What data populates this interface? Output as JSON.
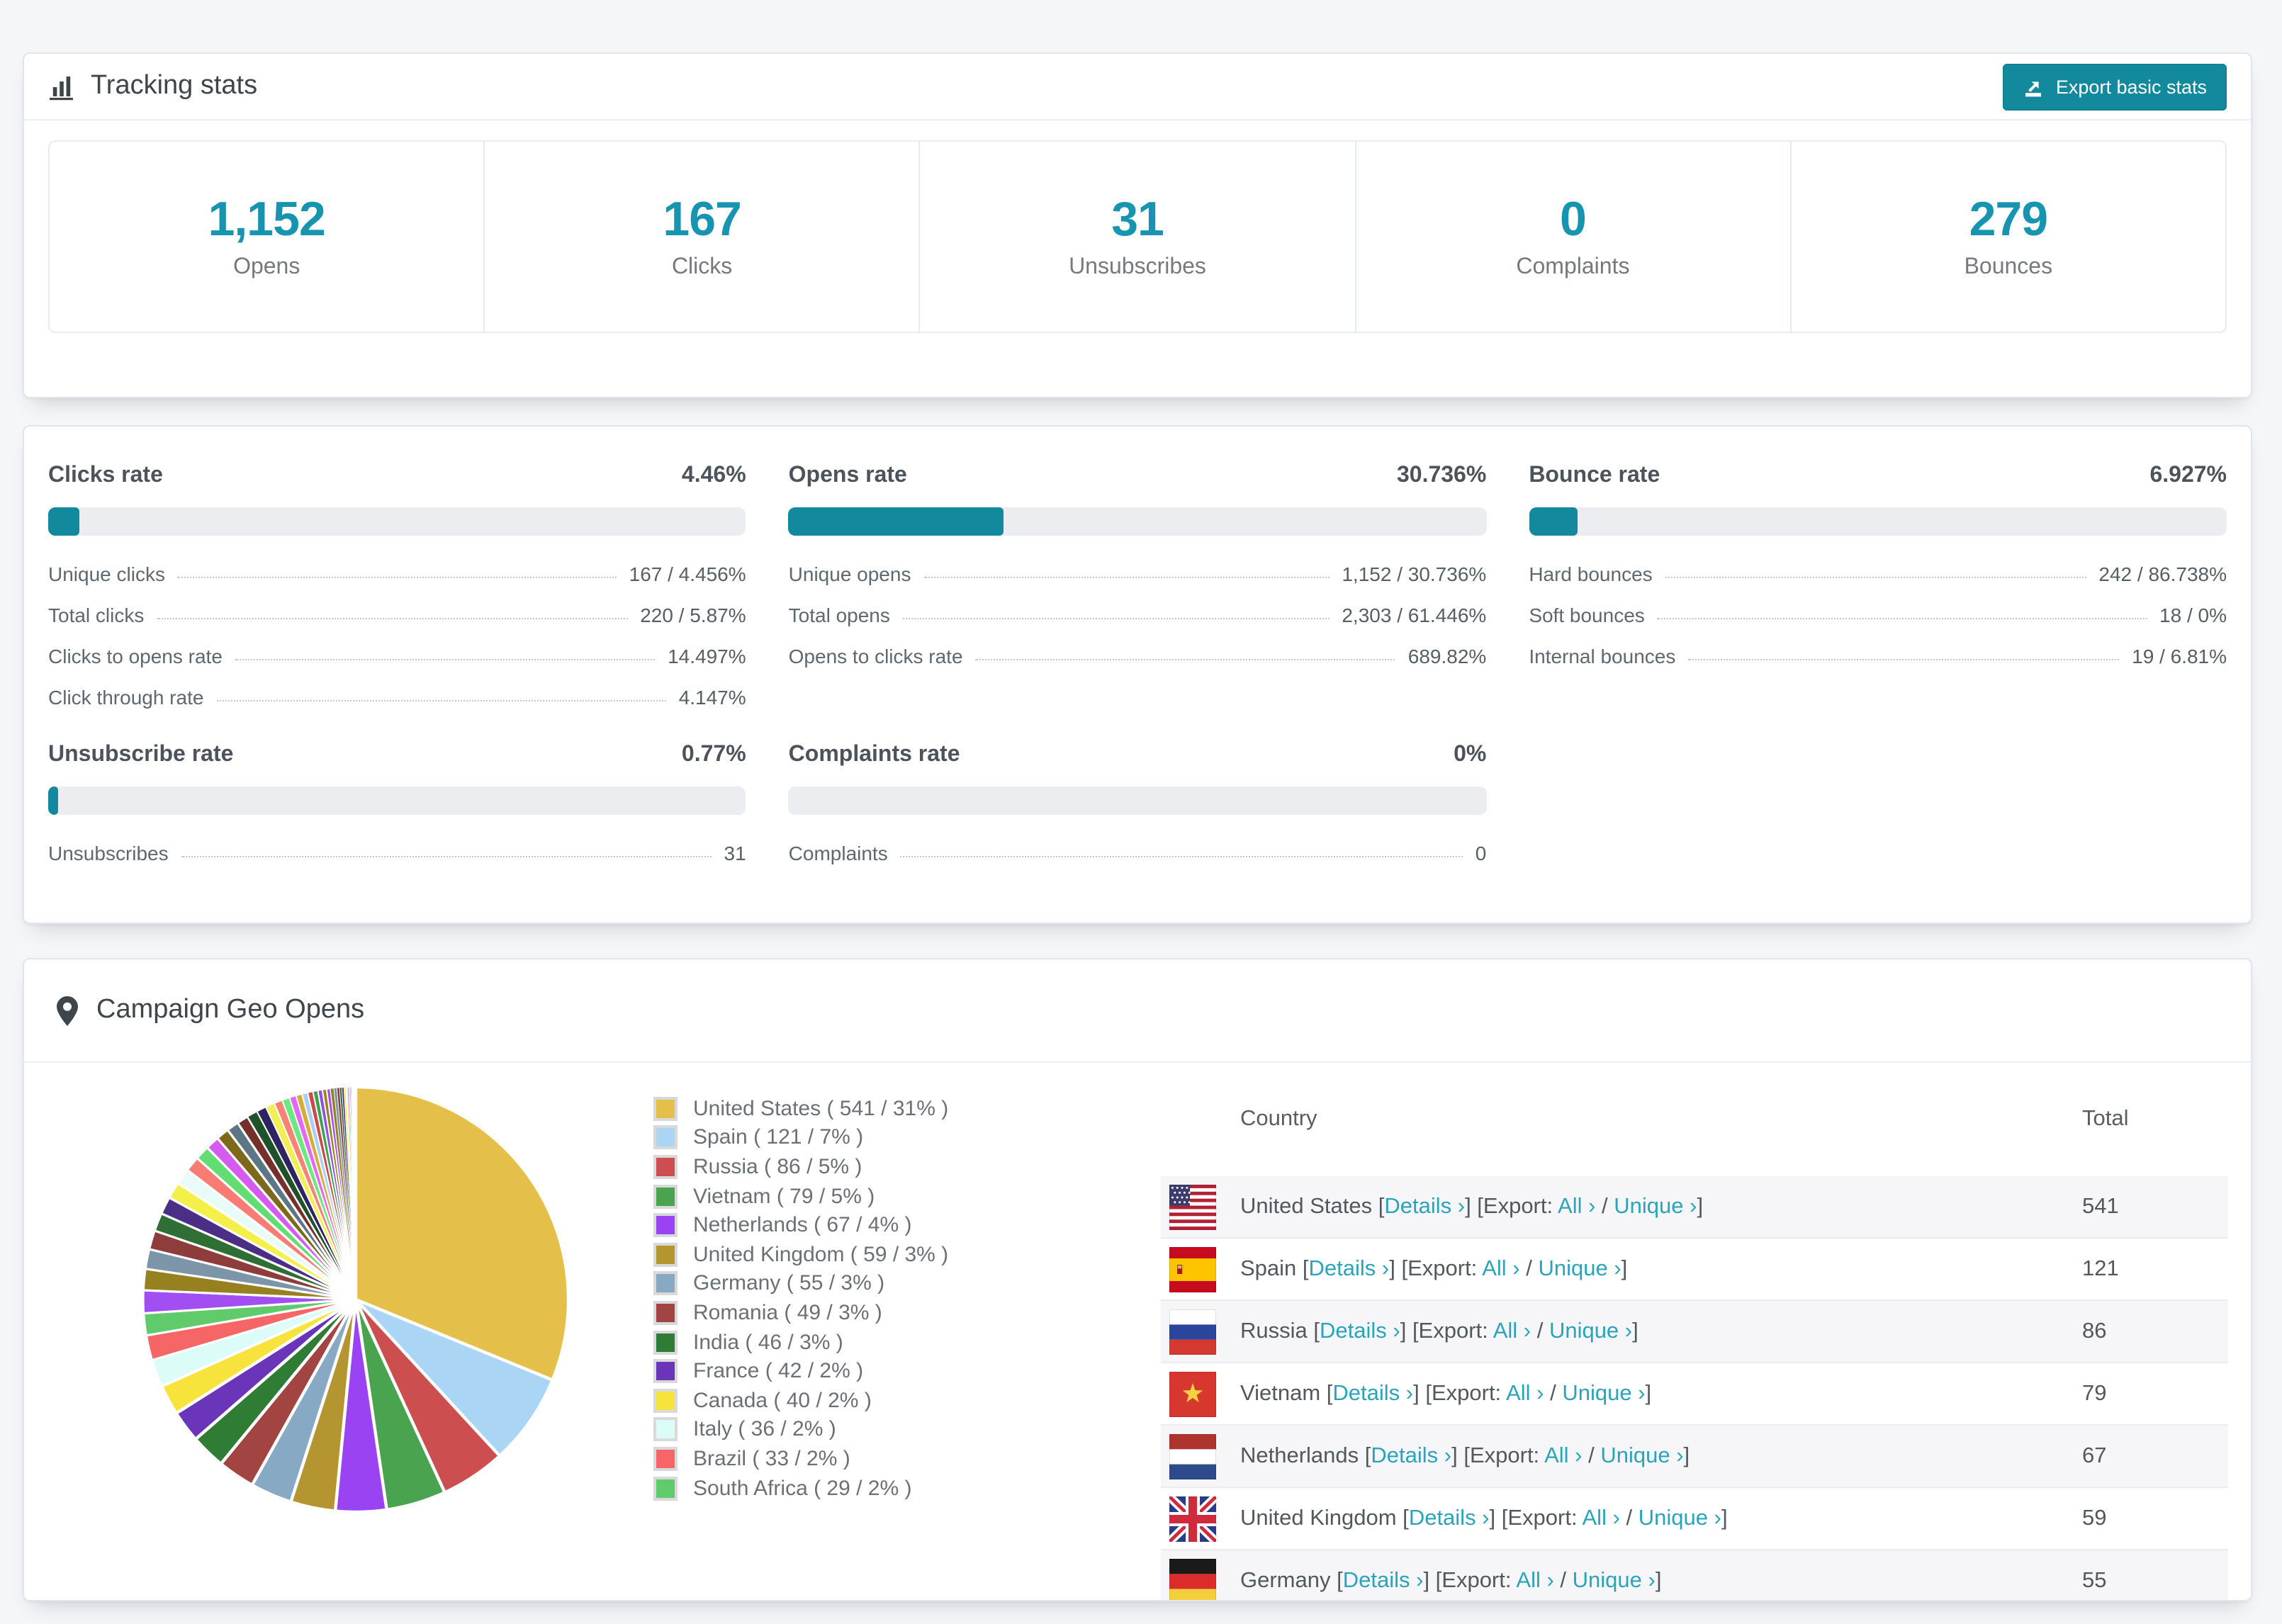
{
  "colors": {
    "accent_teal": "#13899e",
    "number_teal": "#1794b0",
    "link_teal": "#2aa4ba",
    "bar_track": "#ecedf0",
    "page_bg": "#f5f6f8"
  },
  "tracking": {
    "title": "Tracking stats",
    "export_button": "Export basic stats",
    "stats": [
      {
        "value": "1,152",
        "label": "Opens"
      },
      {
        "value": "167",
        "label": "Clicks"
      },
      {
        "value": "31",
        "label": "Unsubscribes"
      },
      {
        "value": "0",
        "label": "Complaints"
      },
      {
        "value": "279",
        "label": "Bounces"
      }
    ]
  },
  "rates": [
    {
      "title": "Clicks rate",
      "value": "4.46%",
      "percent": 4.46,
      "rows": [
        [
          "Unique clicks",
          "167 / 4.456%"
        ],
        [
          "Total clicks",
          "220 / 5.87%"
        ],
        [
          "Clicks to opens rate",
          "14.497%"
        ],
        [
          "Click through rate",
          "4.147%"
        ]
      ]
    },
    {
      "title": "Opens rate",
      "value": "30.736%",
      "percent": 30.736,
      "rows": [
        [
          "Unique opens",
          "1,152 / 30.736%"
        ],
        [
          "Total opens",
          "2,303 / 61.446%"
        ],
        [
          "Opens to clicks rate",
          "689.82%"
        ]
      ]
    },
    {
      "title": "Bounce rate",
      "value": "6.927%",
      "percent": 6.927,
      "rows": [
        [
          "Hard bounces",
          "242 / 86.738%"
        ],
        [
          "Soft bounces",
          "18 / 0%"
        ],
        [
          "Internal bounces",
          "19 / 6.81%"
        ]
      ]
    },
    {
      "title": "Unsubscribe rate",
      "value": "0.77%",
      "percent": 0.77,
      "rows": [
        [
          "Unsubscribes",
          "31"
        ]
      ]
    },
    {
      "title": "Complaints rate",
      "value": "0%",
      "percent": 0,
      "rows": [
        [
          "Complaints",
          "0"
        ]
      ]
    }
  ],
  "geo": {
    "title": "Campaign Geo Opens",
    "legend": [
      {
        "label": "United States ( 541 / 31% )",
        "color": "#e4c04b"
      },
      {
        "label": "Spain ( 121 / 7% )",
        "color": "#abd5f4"
      },
      {
        "label": "Russia ( 86 / 5% )",
        "color": "#cd4e4e"
      },
      {
        "label": "Vietnam ( 79 / 5% )",
        "color": "#4aa44f"
      },
      {
        "label": "Netherlands ( 67 / 4% )",
        "color": "#9a43f2"
      },
      {
        "label": "United Kingdom ( 59 / 3% )",
        "color": "#b5952f"
      },
      {
        "label": "Germany ( 55 / 3% )",
        "color": "#88a9c4"
      },
      {
        "label": "Romania ( 49 / 3% )",
        "color": "#a24441"
      },
      {
        "label": "India ( 46 / 3% )",
        "color": "#2f7c35"
      },
      {
        "label": "France ( 42 / 2% )",
        "color": "#6a35b9"
      },
      {
        "label": "Canada ( 40 / 2% )",
        "color": "#f8e33c"
      },
      {
        "label": "Italy ( 36 / 2% )",
        "color": "#dcfdf7"
      },
      {
        "label": "Brazil ( 33 / 2% )",
        "color": "#f76666"
      },
      {
        "label": "South Africa ( 29 / 2% )",
        "color": "#5fcb6b"
      }
    ],
    "table": {
      "headers": [
        "Country",
        "Total"
      ],
      "links": {
        "details": "Details ›",
        "export": "[Export:",
        "all": "All ›",
        "slash": "/",
        "unique": "Unique ›"
      },
      "rows": [
        {
          "country": "United States",
          "flag": "us",
          "total": "541"
        },
        {
          "country": "Spain",
          "flag": "es",
          "total": "121"
        },
        {
          "country": "Russia",
          "flag": "ru",
          "total": "86"
        },
        {
          "country": "Vietnam",
          "flag": "vn",
          "total": "79"
        },
        {
          "country": "Netherlands",
          "flag": "nl",
          "total": "67"
        },
        {
          "country": "United Kingdom",
          "flag": "gb",
          "total": "59"
        },
        {
          "country": "Germany",
          "flag": "de",
          "total": "55"
        }
      ]
    }
  },
  "chart_data": {
    "type": "pie",
    "title": "Campaign Geo Opens",
    "legend_position": "right",
    "start_angle_deg": 0,
    "direction": "clockwise",
    "series": [
      {
        "label": "United States",
        "value": 541,
        "pct": "31%",
        "color": "#e4c04b"
      },
      {
        "label": "Spain",
        "value": 121,
        "pct": "7%",
        "color": "#abd5f4"
      },
      {
        "label": "Russia",
        "value": 86,
        "pct": "5%",
        "color": "#cd4e4e"
      },
      {
        "label": "Vietnam",
        "value": 79,
        "pct": "5%",
        "color": "#4aa44f"
      },
      {
        "label": "Netherlands",
        "value": 67,
        "pct": "4%",
        "color": "#9a43f2"
      },
      {
        "label": "United Kingdom",
        "value": 59,
        "pct": "3%",
        "color": "#b5952f"
      },
      {
        "label": "Germany",
        "value": 55,
        "pct": "3%",
        "color": "#88a9c4"
      },
      {
        "label": "Romania",
        "value": 49,
        "pct": "3%",
        "color": "#a24441"
      },
      {
        "label": "India",
        "value": 46,
        "pct": "3%",
        "color": "#2f7c35"
      },
      {
        "label": "France",
        "value": 42,
        "pct": "2%",
        "color": "#6a35b9"
      },
      {
        "label": "Canada",
        "value": 40,
        "pct": "2%",
        "color": "#f8e33c"
      },
      {
        "label": "Italy",
        "value": 36,
        "pct": "2%",
        "color": "#dcfdf7"
      },
      {
        "label": "Brazil",
        "value": 33,
        "pct": "2%",
        "color": "#f76666"
      },
      {
        "label": "South Africa",
        "value": 29,
        "pct": "2%",
        "color": "#5fcb6b"
      }
    ],
    "others_estimated_values": [
      30,
      28,
      26,
      25,
      24,
      23,
      22,
      21,
      20,
      19,
      18,
      17,
      16,
      15,
      14,
      13,
      12,
      11,
      10,
      9,
      8,
      7.5,
      7,
      6.5,
      6,
      5.5,
      5,
      4.5,
      4,
      3.5,
      3,
      2.7,
      2.4,
      2.1,
      1.8,
      1.5,
      1.3,
      1.1,
      0.9,
      0.8,
      0.7,
      0.6,
      0.5,
      0.45,
      0.4,
      0.35,
      0.3,
      0.25
    ],
    "others_palette": [
      "#a14ff2",
      "#97801f",
      "#7d95a9",
      "#8f3d3a",
      "#2f6f35",
      "#4b2f86",
      "#f5ef49",
      "#e8fbf6",
      "#f87b74",
      "#62dd72",
      "#d55af0",
      "#7c691c",
      "#5c7685",
      "#772f2c",
      "#1f5228",
      "#2e2560",
      "#f3ee55",
      "#fa8274",
      "#6ce97e",
      "#e468f3",
      "#d7ab39",
      "#abcff2",
      "#c94a47",
      "#3fa04d",
      "#8b52ea",
      "#9b831d"
    ]
  }
}
